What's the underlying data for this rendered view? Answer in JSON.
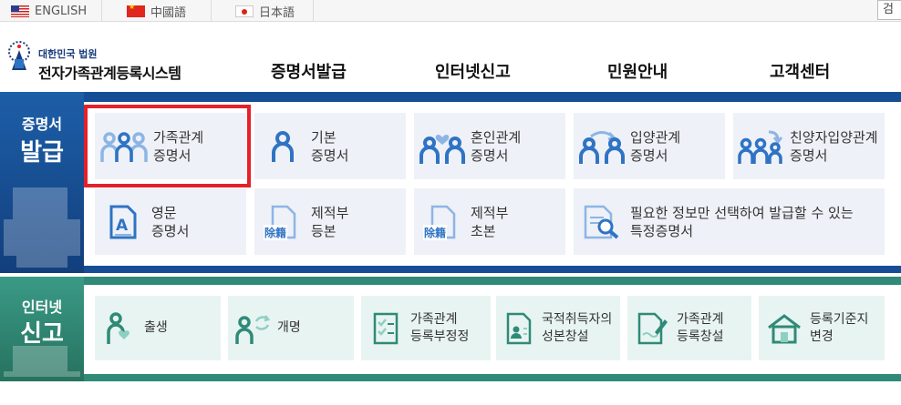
{
  "topbar": {
    "languages": [
      {
        "label": "ENGLISH"
      },
      {
        "label": "中國語"
      },
      {
        "label": "日本語"
      }
    ],
    "search_label": "검"
  },
  "header": {
    "logo_sub": "대한민국 법원",
    "logo_main": "전자가족관계등록시스템",
    "nav": [
      {
        "label": "증명서발급"
      },
      {
        "label": "인터넷신고"
      },
      {
        "label": "민원안내"
      },
      {
        "label": "고객센터"
      }
    ]
  },
  "issue": {
    "title_small": "증명서",
    "title_big": "발급",
    "tiles": [
      {
        "line1": "가족관계",
        "line2": "증명서",
        "icon": "family-icon"
      },
      {
        "line1": "기본",
        "line2": "증명서",
        "icon": "person-icon"
      },
      {
        "line1": "혼인관계",
        "line2": "증명서",
        "icon": "marriage-icon"
      },
      {
        "line1": "입양관계",
        "line2": "증명서",
        "icon": "adoption-icon"
      },
      {
        "line1": "친양자입양관계",
        "line2": "증명서",
        "icon": "full-adoption-icon"
      },
      {
        "line1": "영문",
        "line2": "증명서",
        "icon": "english-doc-icon"
      },
      {
        "line1": "제적부",
        "line2": "등본",
        "icon": "removal-register-icon",
        "badge": "除籍"
      },
      {
        "line1": "제적부",
        "line2": "초본",
        "icon": "removal-register-icon",
        "badge": "除籍"
      },
      {
        "line1": "필요한 정보만 선택하여 발급할 수 있는",
        "line2": "특정증명서",
        "icon": "doc-search-icon"
      }
    ]
  },
  "report": {
    "title_small": "인터넷",
    "title_big": "신고",
    "tiles": [
      {
        "line1": "출생",
        "line2": "",
        "icon": "birth-icon"
      },
      {
        "line1": "개명",
        "line2": "",
        "icon": "rename-icon"
      },
      {
        "line1": "가족관계",
        "line2": "등록부정정",
        "icon": "checklist-icon"
      },
      {
        "line1": "국적취득자의",
        "line2": "성본창설",
        "icon": "id-doc-icon"
      },
      {
        "line1": "가족관계",
        "line2": "등록창설",
        "icon": "doc-pen-icon"
      },
      {
        "line1": "등록기준지",
        "line2": "변경",
        "icon": "house-icon"
      }
    ]
  },
  "colors": {
    "issue_bg": "#164e96",
    "report_bg": "#2f8a78",
    "issue_icon": "#2f73c4",
    "issue_icon_light": "#8cb5e6",
    "report_icon": "#2f8a78",
    "highlight": "#e4212b"
  }
}
